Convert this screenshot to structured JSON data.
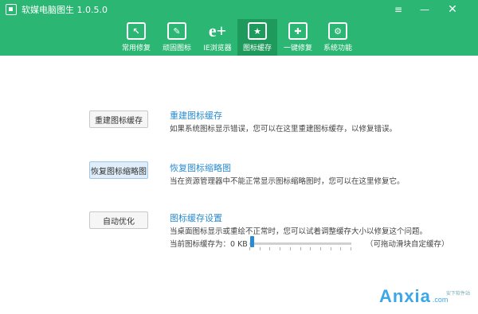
{
  "window": {
    "title": "软媒电脑图生 1.0.5.0",
    "controls": {
      "menu_icon": "≡",
      "minimize_icon": "—",
      "close_icon": "✕"
    }
  },
  "toolbar": {
    "tabs": [
      {
        "label": "常用修复",
        "icon": "repair-icon",
        "glyph": "↖",
        "active": false
      },
      {
        "label": "顽固图标",
        "icon": "tools-icon",
        "glyph": "✎",
        "active": false
      },
      {
        "label": "IE浏览器",
        "icon": "ie-icon",
        "glyph": "e+",
        "active": false
      },
      {
        "label": "图标缓存",
        "icon": "star-icon",
        "glyph": "★",
        "active": true
      },
      {
        "label": "一键修复",
        "icon": "shield-icon",
        "glyph": "✚",
        "active": false
      },
      {
        "label": "系统功能",
        "icon": "gear-icon",
        "glyph": "⚙",
        "active": false
      }
    ]
  },
  "rows": [
    {
      "button": "重建图标缓存",
      "title": "重建图标缓存",
      "desc": "如果系统图标显示错误，您可以在这里重建图标缓存，以修复错误。"
    },
    {
      "button": "恢复图标缩略图",
      "title": "恢复图标缩略图",
      "desc": "当在资源管理器中不能正常显示图标缩略图时，您可以在这里修复它。"
    },
    {
      "button": "自动优化",
      "title": "图标缓存设置",
      "desc": "当桌面图标显示或重绘不正常时，您可以试着调整缓存大小以修复这个问题。"
    }
  ],
  "cache": {
    "label": "当前图标缓存为：0 KB",
    "hint": "（可拖动滑块自定缓存）",
    "value": 0
  },
  "watermark": {
    "text": "Anxia",
    "dot": ".com",
    "tag": "安下软件站"
  },
  "colors": {
    "accent": "#2bb673",
    "accent_active": "#1e9a5c",
    "link": "#2a8bd0"
  }
}
